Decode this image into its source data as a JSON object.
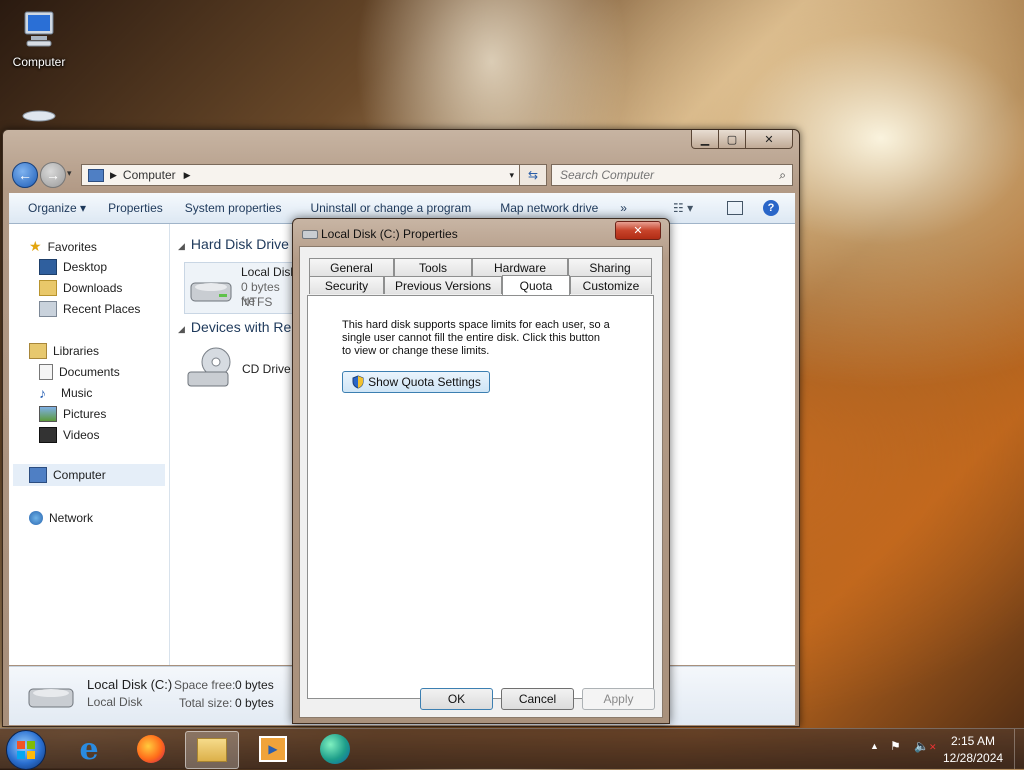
{
  "desktop": {
    "computer_label": "Computer"
  },
  "explorer": {
    "address_root": "Computer",
    "search_placeholder": "Search Computer",
    "commands": [
      "Organize ▾",
      "Properties",
      "System properties",
      "Uninstall or change a program",
      "Map network drive",
      "»"
    ],
    "nav": {
      "favorites": "Favorites",
      "desktop": "Desktop",
      "downloads": "Downloads",
      "recent": "Recent Places",
      "libraries": "Libraries",
      "documents": "Documents",
      "music": "Music",
      "pictures": "Pictures",
      "videos": "Videos",
      "computer": "Computer",
      "network": "Network"
    },
    "groups": {
      "hdd": "Hard Disk Drive",
      "removable": "Devices with Re"
    },
    "local_disk": {
      "name": "Local Disk",
      "free": "0 bytes fre",
      "fs": "NTFS"
    },
    "cd_drive": "CD Drive (",
    "details": {
      "name": "Local Disk (C:)",
      "type": "Local Disk",
      "space_free_label": "Space free:",
      "space_free_value": "0 bytes",
      "total_label": "Total size:",
      "total_value": "0 bytes"
    }
  },
  "dialog": {
    "title": "Local Disk (C:) Properties",
    "tabs_row1": [
      "General",
      "Tools",
      "Hardware",
      "Sharing"
    ],
    "tabs_row2": [
      "Security",
      "Previous Versions",
      "Quota",
      "Customize"
    ],
    "active_tab": "Quota",
    "description": "This hard disk supports space limits for each user, so a single user cannot fill the entire disk. Click this button to view or change these limits.",
    "show_quota_button": "Show Quota Settings",
    "ok": "OK",
    "cancel": "Cancel",
    "apply": "Apply"
  },
  "taskbar": {
    "time": "2:15 AM",
    "date": "12/28/2024"
  }
}
